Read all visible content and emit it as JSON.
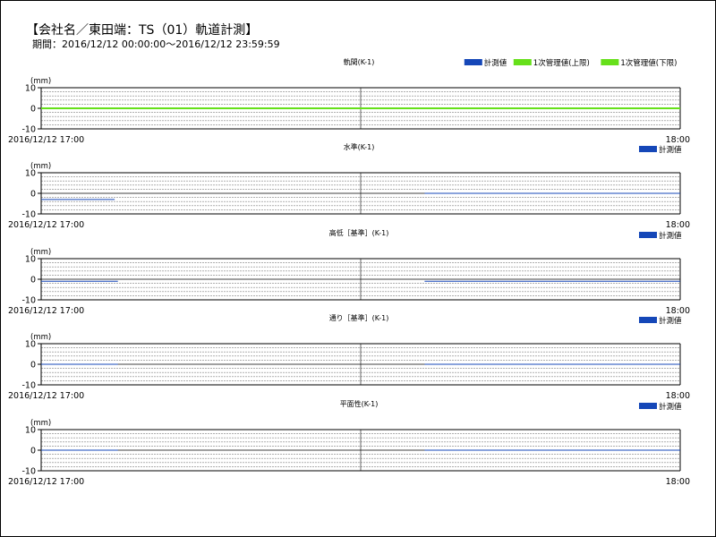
{
  "header": {
    "title": "【会社名／東田端：TS（01）軌道計測】",
    "period": "期間：2016/12/12 00:00:00〜2016/12/12 23:59:59"
  },
  "colors": {
    "measured": "#1547b8",
    "limit_upper": "#66e01a",
    "limit_lower": "#66e01a",
    "grid": "#808080",
    "axis": "#000000"
  },
  "chart_data": [
    {
      "type": "line",
      "title": "軌間(K-1)",
      "ylabel": "(mm)",
      "yticks": [
        10,
        0,
        -10
      ],
      "ylim": [
        -10,
        10
      ],
      "x_start_label": "2016/12/12 17:00",
      "x_end_label": "18:00",
      "legend": [
        "計測値",
        "1次管理値(上限)",
        "1次管理値(下限)"
      ],
      "series": [
        {
          "name": "計測値",
          "color": "#1547b8",
          "segments": [
            [
              [
                0,
                0
              ],
              [
                1,
                0
              ]
            ]
          ]
        },
        {
          "name": "1次管理値(上限)",
          "color": "#66e01a",
          "segments": [
            [
              [
                0,
                0
              ],
              [
                1,
                0
              ]
            ]
          ]
        },
        {
          "name": "1次管理値(下限)",
          "color": "#66e01a",
          "segments": [
            [
              [
                0,
                0
              ],
              [
                1,
                0
              ]
            ]
          ]
        }
      ]
    },
    {
      "type": "line",
      "title": "水準(K-1)",
      "ylabel": "(mm)",
      "yticks": [
        10,
        0,
        -10
      ],
      "ylim": [
        -10,
        10
      ],
      "x_start_label": "2016/12/12 17:00",
      "x_end_label": "18:00",
      "legend": [
        "計測値"
      ],
      "series": [
        {
          "name": "計測値",
          "color": "#1547b8",
          "segments": [
            [
              [
                0,
                -3
              ],
              [
                0.115,
                -3
              ]
            ],
            [
              [
                0.6,
                0
              ],
              [
                1,
                0
              ]
            ]
          ]
        }
      ]
    },
    {
      "type": "line",
      "title": "高低［基準］(K-1)",
      "ylabel": "(mm)",
      "yticks": [
        10,
        0,
        -10
      ],
      "ylim": [
        -10,
        10
      ],
      "x_start_label": "2016/12/12 17:00",
      "x_end_label": "18:00",
      "legend": [
        "計測値"
      ],
      "series": [
        {
          "name": "計測値",
          "color": "#1547b8",
          "segments": [
            [
              [
                0,
                -1
              ],
              [
                0.12,
                -1
              ]
            ],
            [
              [
                0.6,
                -1
              ],
              [
                1,
                -1
              ]
            ]
          ]
        }
      ]
    },
    {
      "type": "line",
      "title": "通り［基準］(K-1)",
      "ylabel": "(mm)",
      "yticks": [
        10,
        0,
        -10
      ],
      "ylim": [
        -10,
        10
      ],
      "x_start_label": "2016/12/12 17:00",
      "x_end_label": "18:00",
      "legend": [
        "計測値"
      ],
      "series": [
        {
          "name": "計測値",
          "color": "#1547b8",
          "segments": [
            [
              [
                0,
                0
              ],
              [
                0.12,
                0
              ]
            ],
            [
              [
                0.6,
                0
              ],
              [
                1,
                0
              ]
            ]
          ]
        }
      ]
    },
    {
      "type": "line",
      "title": "平面性(K-1)",
      "ylabel": "(mm)",
      "yticks": [
        10,
        0,
        -10
      ],
      "ylim": [
        -10,
        10
      ],
      "x_start_label": "2016/12/12 17:00",
      "x_end_label": "18:00",
      "legend": [
        "計測値"
      ],
      "series": [
        {
          "name": "計測値",
          "color": "#1547b8",
          "segments": [
            [
              [
                0,
                0
              ],
              [
                0.12,
                0
              ]
            ],
            [
              [
                0.6,
                0
              ],
              [
                1,
                0
              ]
            ]
          ]
        }
      ]
    }
  ]
}
